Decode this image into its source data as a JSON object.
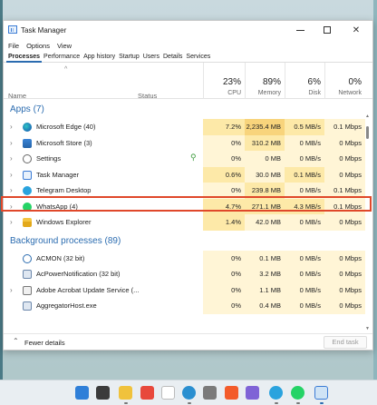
{
  "window": {
    "title": "Task Manager"
  },
  "menu": [
    "File",
    "Options",
    "View"
  ],
  "tabs": [
    "Processes",
    "Performance",
    "App history",
    "Startup",
    "Users",
    "Details",
    "Services"
  ],
  "columns": {
    "name": "Name",
    "status": "Status",
    "cpu": {
      "pct": "23%",
      "label": "CPU"
    },
    "memory": {
      "pct": "89%",
      "label": "Memory"
    },
    "disk": {
      "pct": "6%",
      "label": "Disk"
    },
    "network": {
      "pct": "0%",
      "label": "Network"
    }
  },
  "apps": {
    "title": "Apps (7)",
    "rows": [
      {
        "name": "Microsoft Edge (40)",
        "cpu": "7.2%",
        "mem": "2,235.4 MB",
        "disk": "0.5 MB/s",
        "net": "0.1 Mbps",
        "icon": "edge-icon"
      },
      {
        "name": "Microsoft Store (3)",
        "cpu": "0%",
        "mem": "310.2 MB",
        "disk": "0 MB/s",
        "net": "0 Mbps",
        "icon": "store-icon"
      },
      {
        "name": "Settings",
        "cpu": "0%",
        "mem": "0 MB",
        "disk": "0 MB/s",
        "net": "0 Mbps",
        "icon": "settings-icon"
      },
      {
        "name": "Task Manager",
        "cpu": "0.6%",
        "mem": "30.0 MB",
        "disk": "0.1 MB/s",
        "net": "0 Mbps",
        "icon": "task-manager-icon"
      },
      {
        "name": "Telegram Desktop",
        "cpu": "0%",
        "mem": "239.8 MB",
        "disk": "0 MB/s",
        "net": "0.1 Mbps",
        "icon": "telegram-icon"
      },
      {
        "name": "WhatsApp (4)",
        "cpu": "4.7%",
        "mem": "271.1 MB",
        "disk": "4.3 MB/s",
        "net": "0.1 Mbps",
        "icon": "whatsapp-icon"
      },
      {
        "name": "Windows Explorer",
        "cpu": "1.4%",
        "mem": "42.0 MB",
        "disk": "0 MB/s",
        "net": "0 Mbps",
        "icon": "explorer-icon"
      }
    ]
  },
  "background": {
    "title": "Background processes (89)",
    "rows": [
      {
        "name": "ACMON (32 bit)",
        "cpu": "0%",
        "mem": "0.1 MB",
        "disk": "0 MB/s",
        "net": "0 Mbps",
        "icon": "gear-icon"
      },
      {
        "name": "AcPowerNotification (32 bit)",
        "cpu": "0%",
        "mem": "3.2 MB",
        "disk": "0 MB/s",
        "net": "0 Mbps",
        "icon": "window-icon"
      },
      {
        "name": "Adobe Acrobat Update Service (...",
        "cpu": "0%",
        "mem": "1.1 MB",
        "disk": "0 MB/s",
        "net": "0 Mbps",
        "icon": "acrobat-icon"
      },
      {
        "name": "AggregatorHost.exe",
        "cpu": "0%",
        "mem": "0.4 MB",
        "disk": "0 MB/s",
        "net": "0 Mbps",
        "icon": "window-icon"
      }
    ]
  },
  "footer": {
    "fewer_details": "Fewer details",
    "end_task": "End task"
  },
  "colors": {
    "accent": "#2b6cb0",
    "highlight": "#e0482a",
    "heat_light": "#fff5d6",
    "heat_mid": "#fde9a8",
    "heat_strong": "#f8d47c"
  }
}
